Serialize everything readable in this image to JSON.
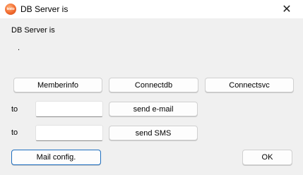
{
  "window": {
    "title": "DB Server is",
    "app_icon_text": "testo",
    "close_glyph": "✕"
  },
  "message": {
    "line1": "DB Server is",
    "line2": "."
  },
  "buttons": {
    "memberinfo": "Memberinfo",
    "connectdb": "Connectdb",
    "connectsvc": "Connectsvc",
    "send_email": "send e-mail",
    "send_sms": "send SMS",
    "mail_config": "Mail config.",
    "ok": "OK"
  },
  "fields": {
    "email_to_label": "to",
    "email_to_value": "",
    "sms_to_label": "to",
    "sms_to_value": ""
  },
  "icons": {
    "app": "testo-app-icon",
    "close": "close-icon"
  }
}
